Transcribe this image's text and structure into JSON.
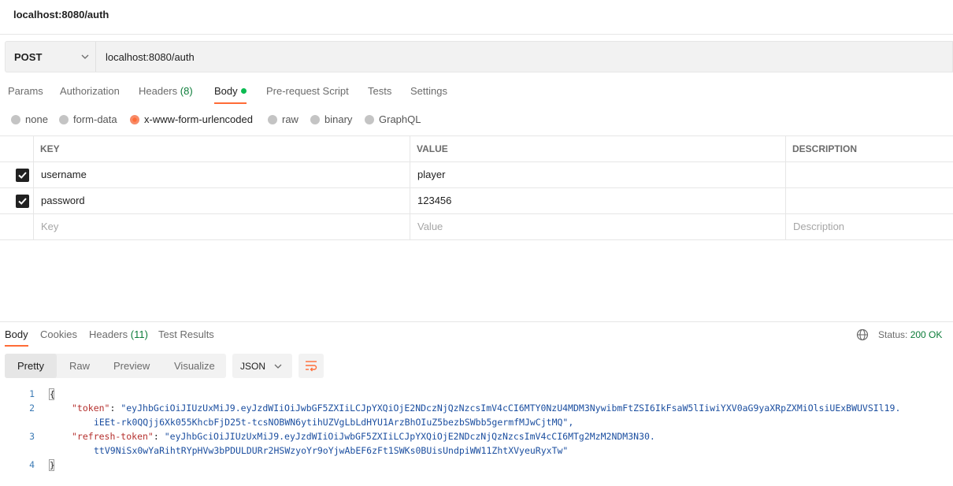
{
  "request": {
    "title": "localhost:8080/auth",
    "method": "POST",
    "url": "localhost:8080/auth"
  },
  "request_tabs": {
    "params": "Params",
    "authorization": "Authorization",
    "headers": "Headers",
    "headers_count": "(8)",
    "body": "Body",
    "prerequest": "Pre-request Script",
    "tests": "Tests",
    "settings": "Settings"
  },
  "body_types": {
    "none": "none",
    "form_data": "form-data",
    "urlencoded": "x-www-form-urlencoded",
    "raw": "raw",
    "binary": "binary",
    "graphql": "GraphQL",
    "selected": "x-www-form-urlencoded"
  },
  "params_table": {
    "headers": {
      "key": "KEY",
      "value": "VALUE",
      "description": "DESCRIPTION"
    },
    "rows": [
      {
        "checked": true,
        "key": "username",
        "value": "player",
        "description": ""
      },
      {
        "checked": true,
        "key": "password",
        "value": "123456",
        "description": ""
      }
    ],
    "placeholder": {
      "key": "Key",
      "value": "Value",
      "description": "Description"
    }
  },
  "response_tabs": {
    "body": "Body",
    "cookies": "Cookies",
    "headers": "Headers",
    "headers_count": "(11)",
    "test_results": "Test Results"
  },
  "status": {
    "label": "Status:",
    "value": "200 OK"
  },
  "view_modes": {
    "pretty": "Pretty",
    "raw": "Raw",
    "preview": "Preview",
    "visualize": "Visualize"
  },
  "format": "JSON",
  "response_body": {
    "line_numbers": [
      "1",
      "2",
      "3",
      "4"
    ],
    "open_brace": "{",
    "close_brace": "}",
    "token_key": "\"token\"",
    "token_value_1": "\"eyJhbGciOiJIUzUxMiJ9.eyJzdWIiOiJwbGF5ZXIiLCJpYXQiOjE2NDczNjQzNzcsImV4cCI6MTY0NzU4MDM3NywibmFtZSI6IkFsaW5lIiwiYXV0aG9yaXRpZXMiOlsiUExBWUVSIl19.",
    "token_value_2": "iEEt-rk0QQjj6Xk055KhcbFjD25t-tcsNOBWN6ytihUZVgLbLdHYU1ArzBhOIuZ5bezbSWbb5germfMJwCjtMQ\",",
    "refresh_key": "\"refresh-token\"",
    "refresh_value_1": "\"eyJhbGciOiJIUzUxMiJ9.eyJzdWIiOiJwbGF5ZXIiLCJpYXQiOjE2NDczNjQzNzcsImV4cCI6MTg2MzM2NDM3N30.",
    "refresh_value_2": "ttV9NiSx0wYaRihtRYpHVw3bPDULDURr2HSWzyoYr9oYjwAbEF6zFt1SWKs0BUisUndpiWW11ZhtXVyeuRyxTw\""
  },
  "colors": {
    "accent": "#ff6c37",
    "status_green": "#0c7c39",
    "dot_green": "#0cbb52",
    "json_key": "#b5302e",
    "json_string": "#1c4fa0"
  }
}
